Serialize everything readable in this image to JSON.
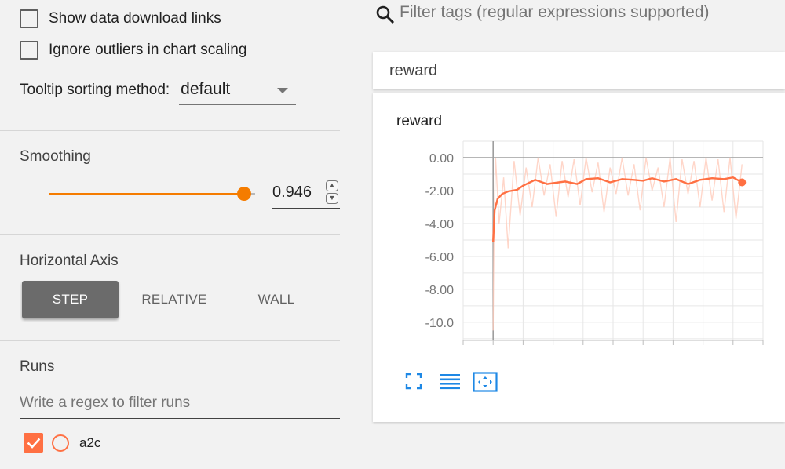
{
  "sidebar": {
    "show_download_label": "Show data download links",
    "ignore_outliers_label": "Ignore outliers in chart scaling",
    "tooltip_label": "Tooltip sorting method:",
    "tooltip_value": "default",
    "smoothing_title": "Smoothing",
    "smoothing_value": "0.946",
    "smoothing_fraction": 0.946,
    "axis_title": "Horizontal Axis",
    "axis_buttons": {
      "step": "STEP",
      "relative": "RELATIVE",
      "wall": "WALL"
    },
    "axis_selected": "step",
    "runs_title": "Runs",
    "runs_filter_placeholder": "Write a regex to filter runs",
    "runs": [
      {
        "name": "a2c",
        "checked": true,
        "color": "#ff7043"
      }
    ]
  },
  "main": {
    "tag_filter_placeholder": "Filter tags (regular expressions supported)",
    "category_header": "reward",
    "card_title": "reward",
    "icons": [
      "fit-icon",
      "toggle-log-scale-icon",
      "fit-domain-icon"
    ]
  },
  "colors": {
    "accent": "#f57c00",
    "series": "#ff7043"
  },
  "chart_data": {
    "type": "line",
    "title": "reward",
    "ytick_labels": [
      "0.00",
      "-2.00",
      "-4.00",
      "-6.00",
      "-8.00",
      "-10.0"
    ],
    "yticks": [
      0,
      -2,
      -4,
      -6,
      -8,
      -10
    ],
    "ylim": [
      -11.1,
      1.0
    ],
    "xlim": [
      -1.0,
      9.0
    ],
    "grid": true,
    "series": [
      {
        "role": "smoothed",
        "color": "#ff7043",
        "x": [
          0.0,
          0.05,
          0.15,
          0.3,
          0.5,
          0.8,
          1.0,
          1.4,
          1.8,
          2.0,
          2.4,
          2.8,
          3.1,
          3.5,
          3.9,
          4.3,
          4.7,
          5.0,
          5.3,
          5.7,
          6.1,
          6.5,
          6.9,
          7.3,
          7.7,
          8.0,
          8.3
        ],
        "y": [
          -5.1,
          -3.2,
          -2.5,
          -2.2,
          -2.05,
          -1.95,
          -1.7,
          -1.35,
          -1.6,
          -1.55,
          -1.45,
          -1.6,
          -1.3,
          -1.25,
          -1.5,
          -1.3,
          -1.35,
          -1.4,
          -1.25,
          -1.45,
          -1.3,
          -1.6,
          -1.35,
          -1.25,
          -1.3,
          -1.2,
          -1.5
        ]
      },
      {
        "role": "raw",
        "color": "#ffccbc",
        "x": [
          0.0,
          0.03,
          0.08,
          0.2,
          0.35,
          0.5,
          0.7,
          0.9,
          1.1,
          1.3,
          1.5,
          1.7,
          1.9,
          2.1,
          2.3,
          2.5,
          2.7,
          2.9,
          3.1,
          3.3,
          3.5,
          3.7,
          3.9,
          4.1,
          4.3,
          4.5,
          4.7,
          4.9,
          5.1,
          5.3,
          5.5,
          5.7,
          5.9,
          6.1,
          6.3,
          6.5,
          6.7,
          6.9,
          7.1,
          7.3,
          7.5,
          7.7,
          7.9,
          8.1,
          8.3
        ],
        "y": [
          -10.5,
          -4.5,
          0.0,
          -4.0,
          -1.2,
          -5.5,
          -0.2,
          -3.5,
          -0.6,
          -3.0,
          0.0,
          -2.3,
          -0.4,
          -3.6,
          -0.2,
          -2.4,
          -0.1,
          -2.9,
          0.0,
          -2.1,
          -0.3,
          -3.3,
          -0.6,
          -2.2,
          0.0,
          -2.3,
          -0.4,
          -3.2,
          0.0,
          -2.0,
          -0.6,
          -3.0,
          0.0,
          -3.9,
          -0.1,
          -2.2,
          -0.2,
          -3.0,
          0.0,
          -2.6,
          -0.1,
          -3.3,
          0.0,
          -3.7,
          -0.4
        ]
      }
    ]
  }
}
